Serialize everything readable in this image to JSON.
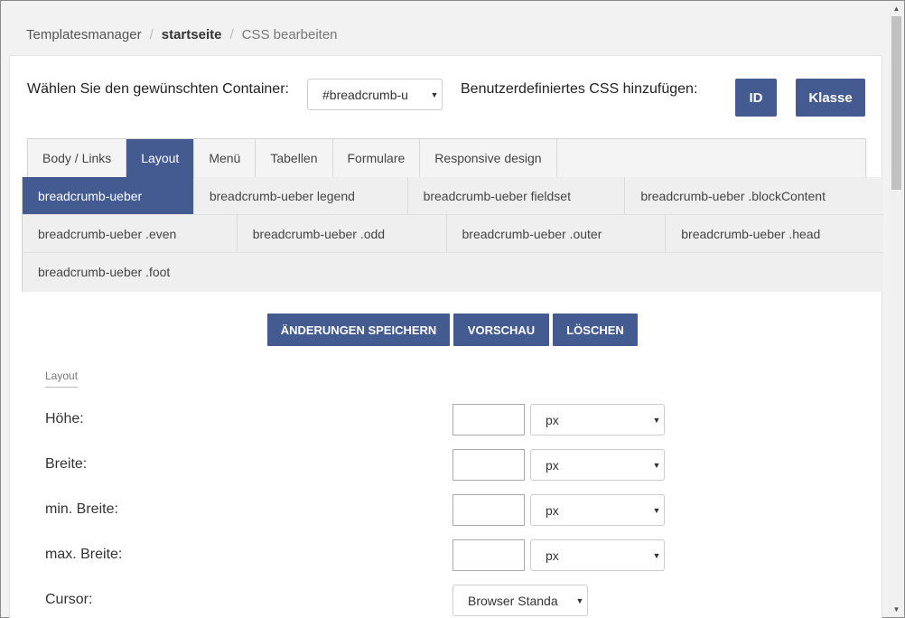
{
  "breadcrumb": {
    "items": [
      "Templatesmanager",
      "startseite",
      "CSS bearbeiten"
    ]
  },
  "container": {
    "label": "Wählen Sie den gewünschten Container:",
    "selected": "#breadcrumb-u"
  },
  "custom_css": {
    "label": "Benutzerdefiniertes CSS hinzufügen:",
    "id_button": "ID",
    "class_button": "Klasse"
  },
  "tabs": [
    "Body / Links",
    "Layout",
    "Menü",
    "Tabellen",
    "Formulare",
    "Responsive design"
  ],
  "active_tab": "Layout",
  "subtabs": {
    "row1": [
      "breadcrumb-ueber",
      "breadcrumb-ueber legend",
      "breadcrumb-ueber fieldset",
      "breadcrumb-ueber .blockContent"
    ],
    "row2": [
      "breadcrumb-ueber .even",
      "breadcrumb-ueber .odd",
      "breadcrumb-ueber .outer",
      "breadcrumb-ueber .head"
    ],
    "row3": [
      "breadcrumb-ueber .foot"
    ]
  },
  "actions": {
    "save": "ÄNDERUNGEN SPEICHERN",
    "preview": "VORSCHAU",
    "delete": "LÖSCHEN"
  },
  "section_title": "Layout",
  "fields": {
    "height": {
      "label": "Höhe:",
      "unit": "px"
    },
    "width": {
      "label": "Breite:",
      "unit": "px"
    },
    "min_width": {
      "label": "min. Breite:",
      "unit": "px"
    },
    "max_width": {
      "label": "max. Breite:",
      "unit": "px"
    },
    "cursor": {
      "label": "Cursor:",
      "value": "Browser Standa"
    }
  },
  "colors": {
    "accent": "#435b91"
  }
}
